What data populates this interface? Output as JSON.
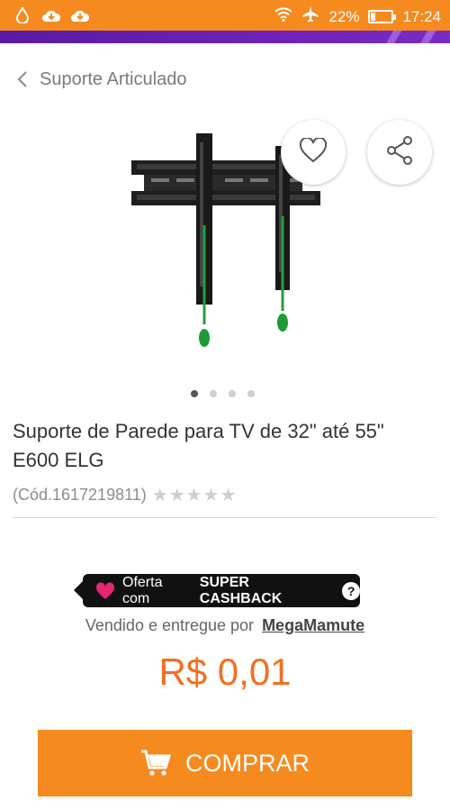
{
  "status_bar": {
    "battery": "22%",
    "battery_level": 0.22,
    "time": "17:24",
    "icons": [
      "drop-icon",
      "cloud-download-icon",
      "cloud-download-icon",
      "wifi-icon",
      "airplane-icon",
      "battery-icon"
    ]
  },
  "header": {
    "back_title": "Suporte Articulado"
  },
  "product": {
    "name": "Suporte de Parede para TV de 32\" até 55\" E600 ELG",
    "code": "(Cód.1617219811)",
    "rating_stars": "★★★★★",
    "image_count": 4,
    "image_active_index": 0
  },
  "offer": {
    "prefix": "Oferta com",
    "highlight": "SUPER CASHBACK",
    "help": "?"
  },
  "seller": {
    "prefix": "Vendido e entregue por",
    "name": "MegaMamute"
  },
  "price": "R$ 0,01",
  "buy_button": {
    "label": "COMPRAR"
  },
  "colors": {
    "accent": "#f58a1f",
    "price": "#f36f21",
    "banner": "#6d22b8",
    "badge_bg": "#111111",
    "heart_pink": "#e8256f"
  }
}
